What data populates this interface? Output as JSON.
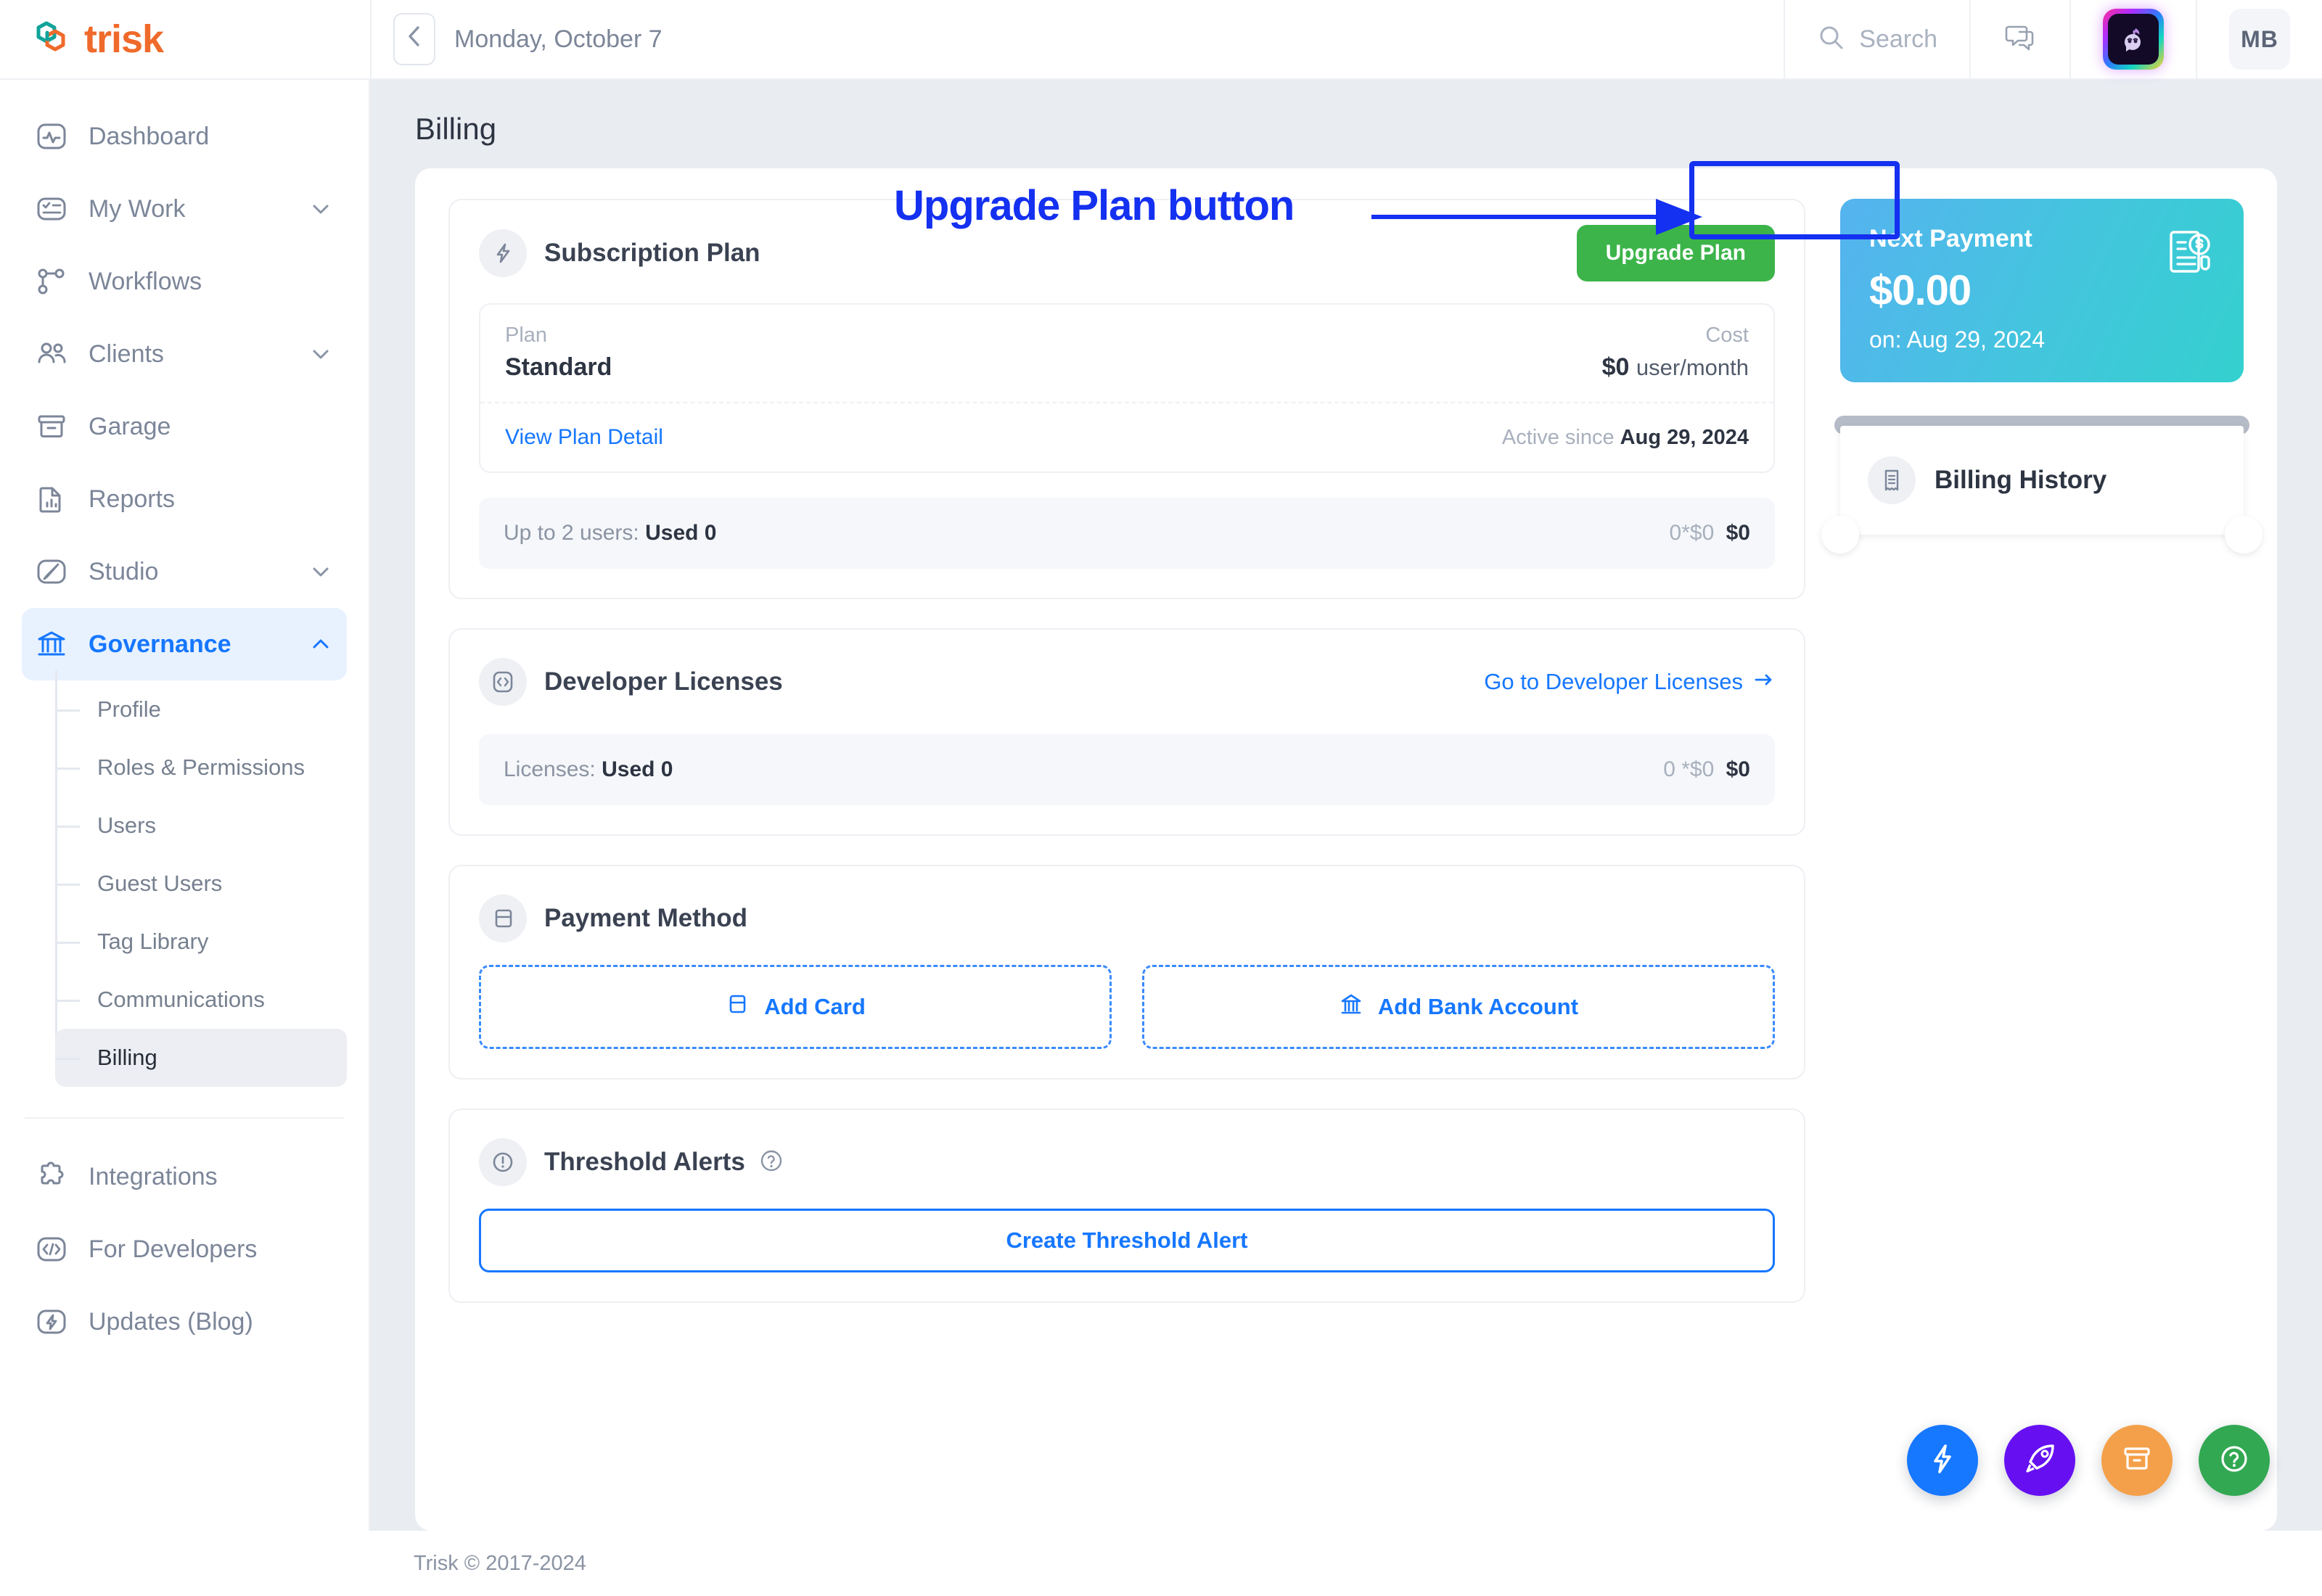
{
  "brand": {
    "name": "trisk",
    "logo_icon": "trisk-hexagon-logo",
    "colors": {
      "orange": "#ef6a2b",
      "teal": "#12a39a"
    }
  },
  "topbar": {
    "collapse_icon": "chevron-left-icon",
    "date": "Monday, October 7",
    "search": {
      "icon": "search-icon",
      "placeholder": "Search",
      "value": "Search"
    },
    "chat_icon": "chat-bubbles-icon",
    "assistant_icon": "ai-assistant-icon",
    "avatar_initials": "MB"
  },
  "sidebar": {
    "items": [
      {
        "label": "Dashboard",
        "icon": "activity-monitor-icon",
        "expandable": false,
        "active": false
      },
      {
        "label": "My Work",
        "icon": "task-list-icon",
        "expandable": true,
        "active": false
      },
      {
        "label": "Workflows",
        "icon": "workflow-branch-icon",
        "expandable": false,
        "active": false
      },
      {
        "label": "Clients",
        "icon": "users-icon",
        "expandable": true,
        "active": false
      },
      {
        "label": "Garage",
        "icon": "archive-box-icon",
        "expandable": false,
        "active": false
      },
      {
        "label": "Reports",
        "icon": "report-chart-icon",
        "expandable": false,
        "active": false
      },
      {
        "label": "Studio",
        "icon": "brush-edit-icon",
        "expandable": true,
        "active": false
      },
      {
        "label": "Governance",
        "icon": "bank-columns-icon",
        "expandable": true,
        "active": true
      }
    ],
    "subitems": [
      {
        "label": "Profile",
        "active": false
      },
      {
        "label": "Roles & Permissions",
        "active": false
      },
      {
        "label": "Users",
        "active": false
      },
      {
        "label": "Guest Users",
        "active": false
      },
      {
        "label": "Tag Library",
        "active": false
      },
      {
        "label": "Communications",
        "active": false
      },
      {
        "label": "Billing",
        "active": true
      }
    ],
    "bottom_items": [
      {
        "label": "Integrations",
        "icon": "puzzle-piece-icon"
      },
      {
        "label": "For Developers",
        "icon": "code-brackets-icon"
      },
      {
        "label": "Updates (Blog)",
        "icon": "lightning-bolt-icon"
      }
    ]
  },
  "page": {
    "title": "Billing"
  },
  "subscription": {
    "icon": "lightning-bolt-icon",
    "title": "Subscription Plan",
    "upgrade_button": "Upgrade Plan",
    "upgrade_button_color": "#3cb44a",
    "plan_header": "Plan",
    "cost_header": "Cost",
    "plan_name": "Standard",
    "cost_amount": "$0",
    "cost_unit": "user/month",
    "view_detail_link": "View Plan Detail",
    "active_since_label": "Active since",
    "active_since_date": "Aug 29, 2024",
    "usage_label": "Up to 2 users:",
    "usage_value": "Used 0",
    "usage_calc": "0*$0",
    "usage_total": "$0"
  },
  "developer_licenses": {
    "icon": "code-brackets-icon",
    "title": "Developer Licenses",
    "go_link": "Go to Developer Licenses",
    "go_link_icon": "arrow-right-icon",
    "usage_label": "Licenses:",
    "usage_value": "Used 0",
    "usage_calc": "0 *$0",
    "usage_total": "$0"
  },
  "payment_method": {
    "icon": "credit-card-icon",
    "title": "Payment Method",
    "add_card": {
      "label": "Add Card",
      "icon": "credit-card-icon"
    },
    "add_bank": {
      "label": "Add Bank Account",
      "icon": "bank-columns-icon"
    }
  },
  "threshold_alerts": {
    "icon": "alert-circle-icon",
    "title": "Threshold Alerts",
    "help_icon": "question-mark-icon",
    "create_button": "Create Threshold Alert"
  },
  "next_payment": {
    "title": "Next Payment",
    "amount": "$0.00",
    "date": "on: Aug 29, 2024",
    "icon": "invoice-dollar-icon",
    "gradient_from": "#55b3ef",
    "gradient_to": "#34d0cf"
  },
  "billing_history": {
    "title": "Billing History",
    "icon": "receipt-icon"
  },
  "annotation": {
    "text": "Upgrade Plan button",
    "color": "#1430f0",
    "arrow_icon": "right-arrow-annotation",
    "highlight_target": "Upgrade Plan"
  },
  "fabs": [
    {
      "name": "quick-action",
      "icon": "lightning-bolt-icon",
      "color": "#1677ff"
    },
    {
      "name": "launch",
      "icon": "rocket-icon",
      "color": "#6610f2"
    },
    {
      "name": "garage",
      "icon": "archive-box-icon",
      "color": "#f4a04a"
    },
    {
      "name": "help",
      "icon": "question-mark-icon",
      "color": "#32a852"
    }
  ],
  "footer": {
    "text": "Trisk © 2017-2024"
  }
}
